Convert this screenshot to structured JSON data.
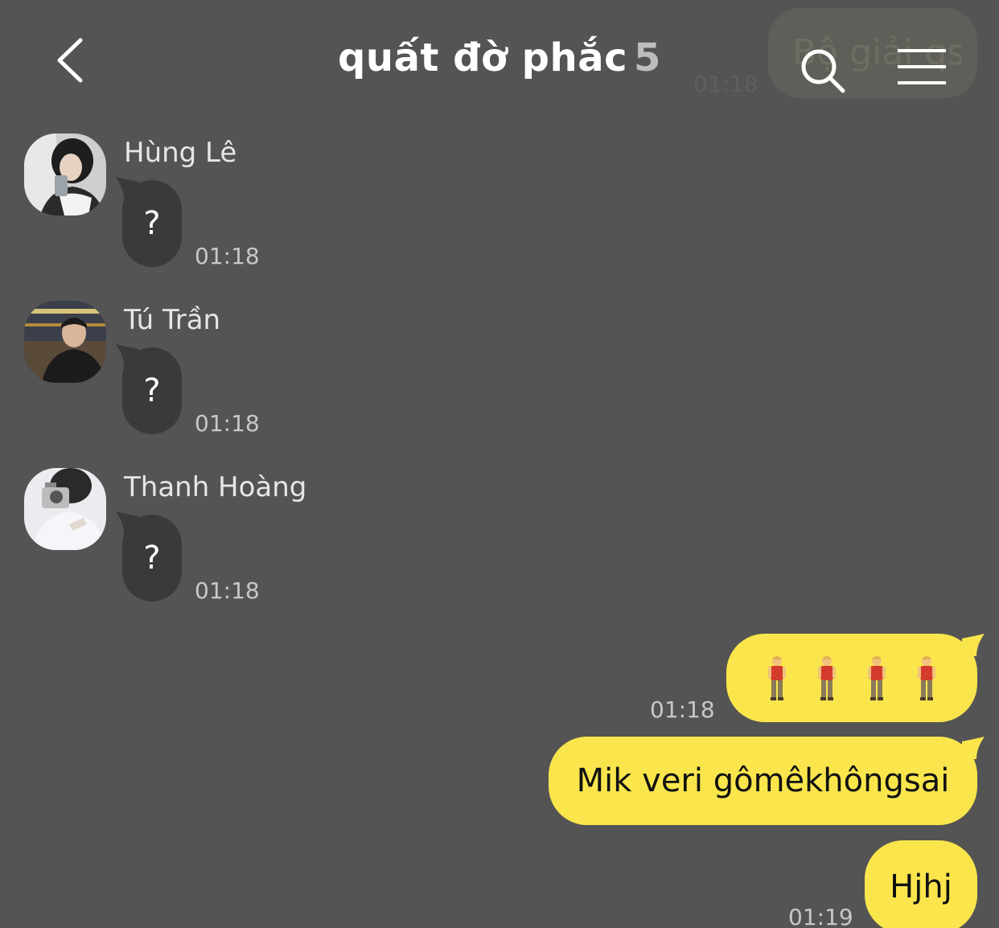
{
  "header": {
    "title": "quất đờ phắc",
    "member_count": "5",
    "ghost_text": "Bộ giải qs",
    "ghost_time": "01:18",
    "back_icon": "chevron-left-icon",
    "search_icon": "search-icon",
    "menu_icon": "hamburger-menu-icon"
  },
  "incoming": [
    {
      "sender": "Hùng Lê",
      "text": "?",
      "time": "01:18"
    },
    {
      "sender": "Tú Trần",
      "text": "?",
      "time": "01:18"
    },
    {
      "sender": "Thanh Hoàng",
      "text": "?",
      "time": "01:18"
    }
  ],
  "outgoing": [
    {
      "content": "🧍‍♂️🧍‍♂️🧍‍♂️🧍‍♂️",
      "time": "01:18"
    },
    {
      "text": "Mik veri gômêkhôngsai"
    },
    {
      "text": "Hjhj",
      "time": "01:19"
    }
  ],
  "colors": {
    "background": "#545454",
    "incoming_bubble": "#3a3a3a",
    "outgoing_bubble": "#fae64c"
  }
}
